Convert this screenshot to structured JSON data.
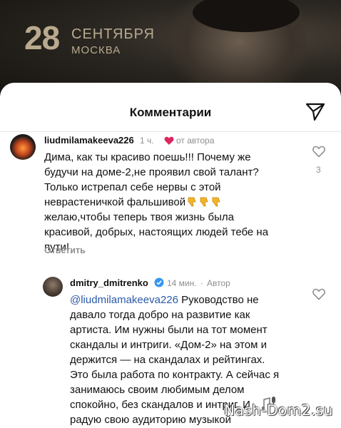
{
  "banner": {
    "day": "28",
    "month": "СЕНТЯБРЯ",
    "city": "МОСКВА"
  },
  "sheet": {
    "title": "Комментарии"
  },
  "comments": [
    {
      "username": "liudmilamakeeva226",
      "time": "1 ч.",
      "author_like": "от автора",
      "text_lines": [
        "Дима, как ты красиво поешь!!! Почему же",
        "будучи на доме-2,не проявил свой талант?",
        "Только истрепал себе нервы с этой",
        "неврастеничкой фальшивой",
        "желаю,чтобы теперь твоя жизнь была",
        "красивой, добрых, настоящих людей тебе на",
        "пути!"
      ],
      "reply_label": "Ответить",
      "like_count": "3"
    },
    {
      "username": "dmitry_dmitrenko",
      "time": "14 мин.",
      "author_label": "Автор",
      "mention": "@liudmilamakeeva226",
      "text_lines": [
        " Руководство не",
        "давало тогда добро на развитие как",
        "артиста. Им нужны были на тот момент",
        "скандалы и интриги. «Дом-2» на этом и",
        "держится — на скандалах и рейтингах.",
        "Это была работа по контракту. А сейчас я",
        "занимаюсь своим любимым делом",
        "спокойно, без скандалов и интриг. И",
        "радую свою аудиторию музыкой"
      ]
    }
  ],
  "watermark": "Nash-Dom2.su",
  "colors": {
    "mention": "#2b5aa8",
    "heart": "#e0245e",
    "verified": "#3897f0"
  }
}
